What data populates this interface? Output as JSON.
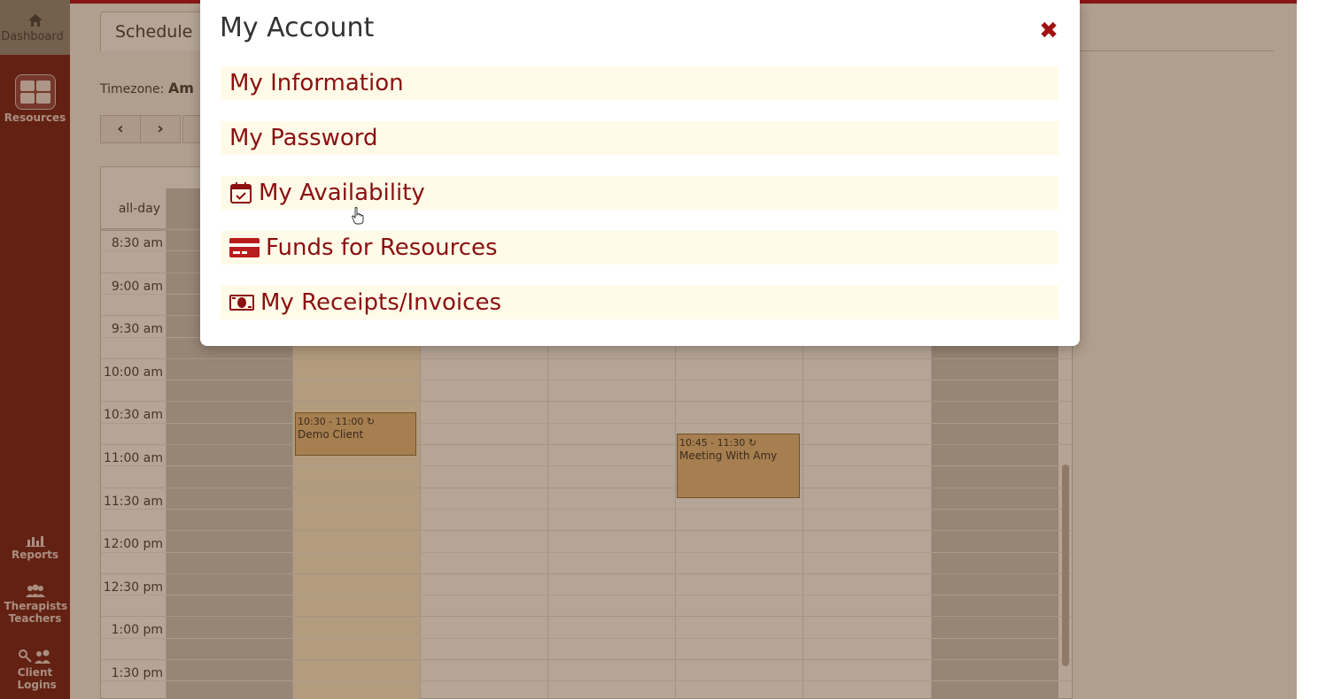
{
  "sidebar": {
    "dashboard_label": "Dashboard",
    "resources_label": "Resources",
    "reports_label": "Reports",
    "therapists_label": "Therapists Teachers",
    "client_logins_label": "Client Logins"
  },
  "schedule": {
    "tab_label": "Schedule",
    "timezone_label": "Timezone:",
    "timezone_value": "Am",
    "prev_label": "‹",
    "next_label": "›",
    "allday_label": "all-day",
    "times": [
      "8:30 am",
      "9:00 am",
      "9:30 am",
      "10:00 am",
      "10:30 am",
      "11:00 am",
      "11:30 am",
      "12:00 pm",
      "12:30 pm",
      "1:00 pm",
      "1:30 pm"
    ],
    "events": [
      {
        "time": "10:30 - 11:00",
        "title": "Demo Client"
      },
      {
        "time": "10:45 - 11:30",
        "title": "Meeting With Amy"
      }
    ]
  },
  "modal": {
    "title": "My Account",
    "close_label": "✖",
    "items": [
      {
        "label": "My Information",
        "icon": "none"
      },
      {
        "label": "My Password",
        "icon": "none"
      },
      {
        "label": "My Availability",
        "icon": "calendar-check-icon"
      },
      {
        "label": "Funds for Resources",
        "icon": "credit-card-icon"
      },
      {
        "label": "My Receipts/Invoices",
        "icon": "money-bill-icon"
      }
    ]
  },
  "colors": {
    "accent": "#8b1010",
    "sidebar": "#6b0f0f",
    "item_bg": "#fffbe8",
    "event_bg": "#e3b97e"
  }
}
